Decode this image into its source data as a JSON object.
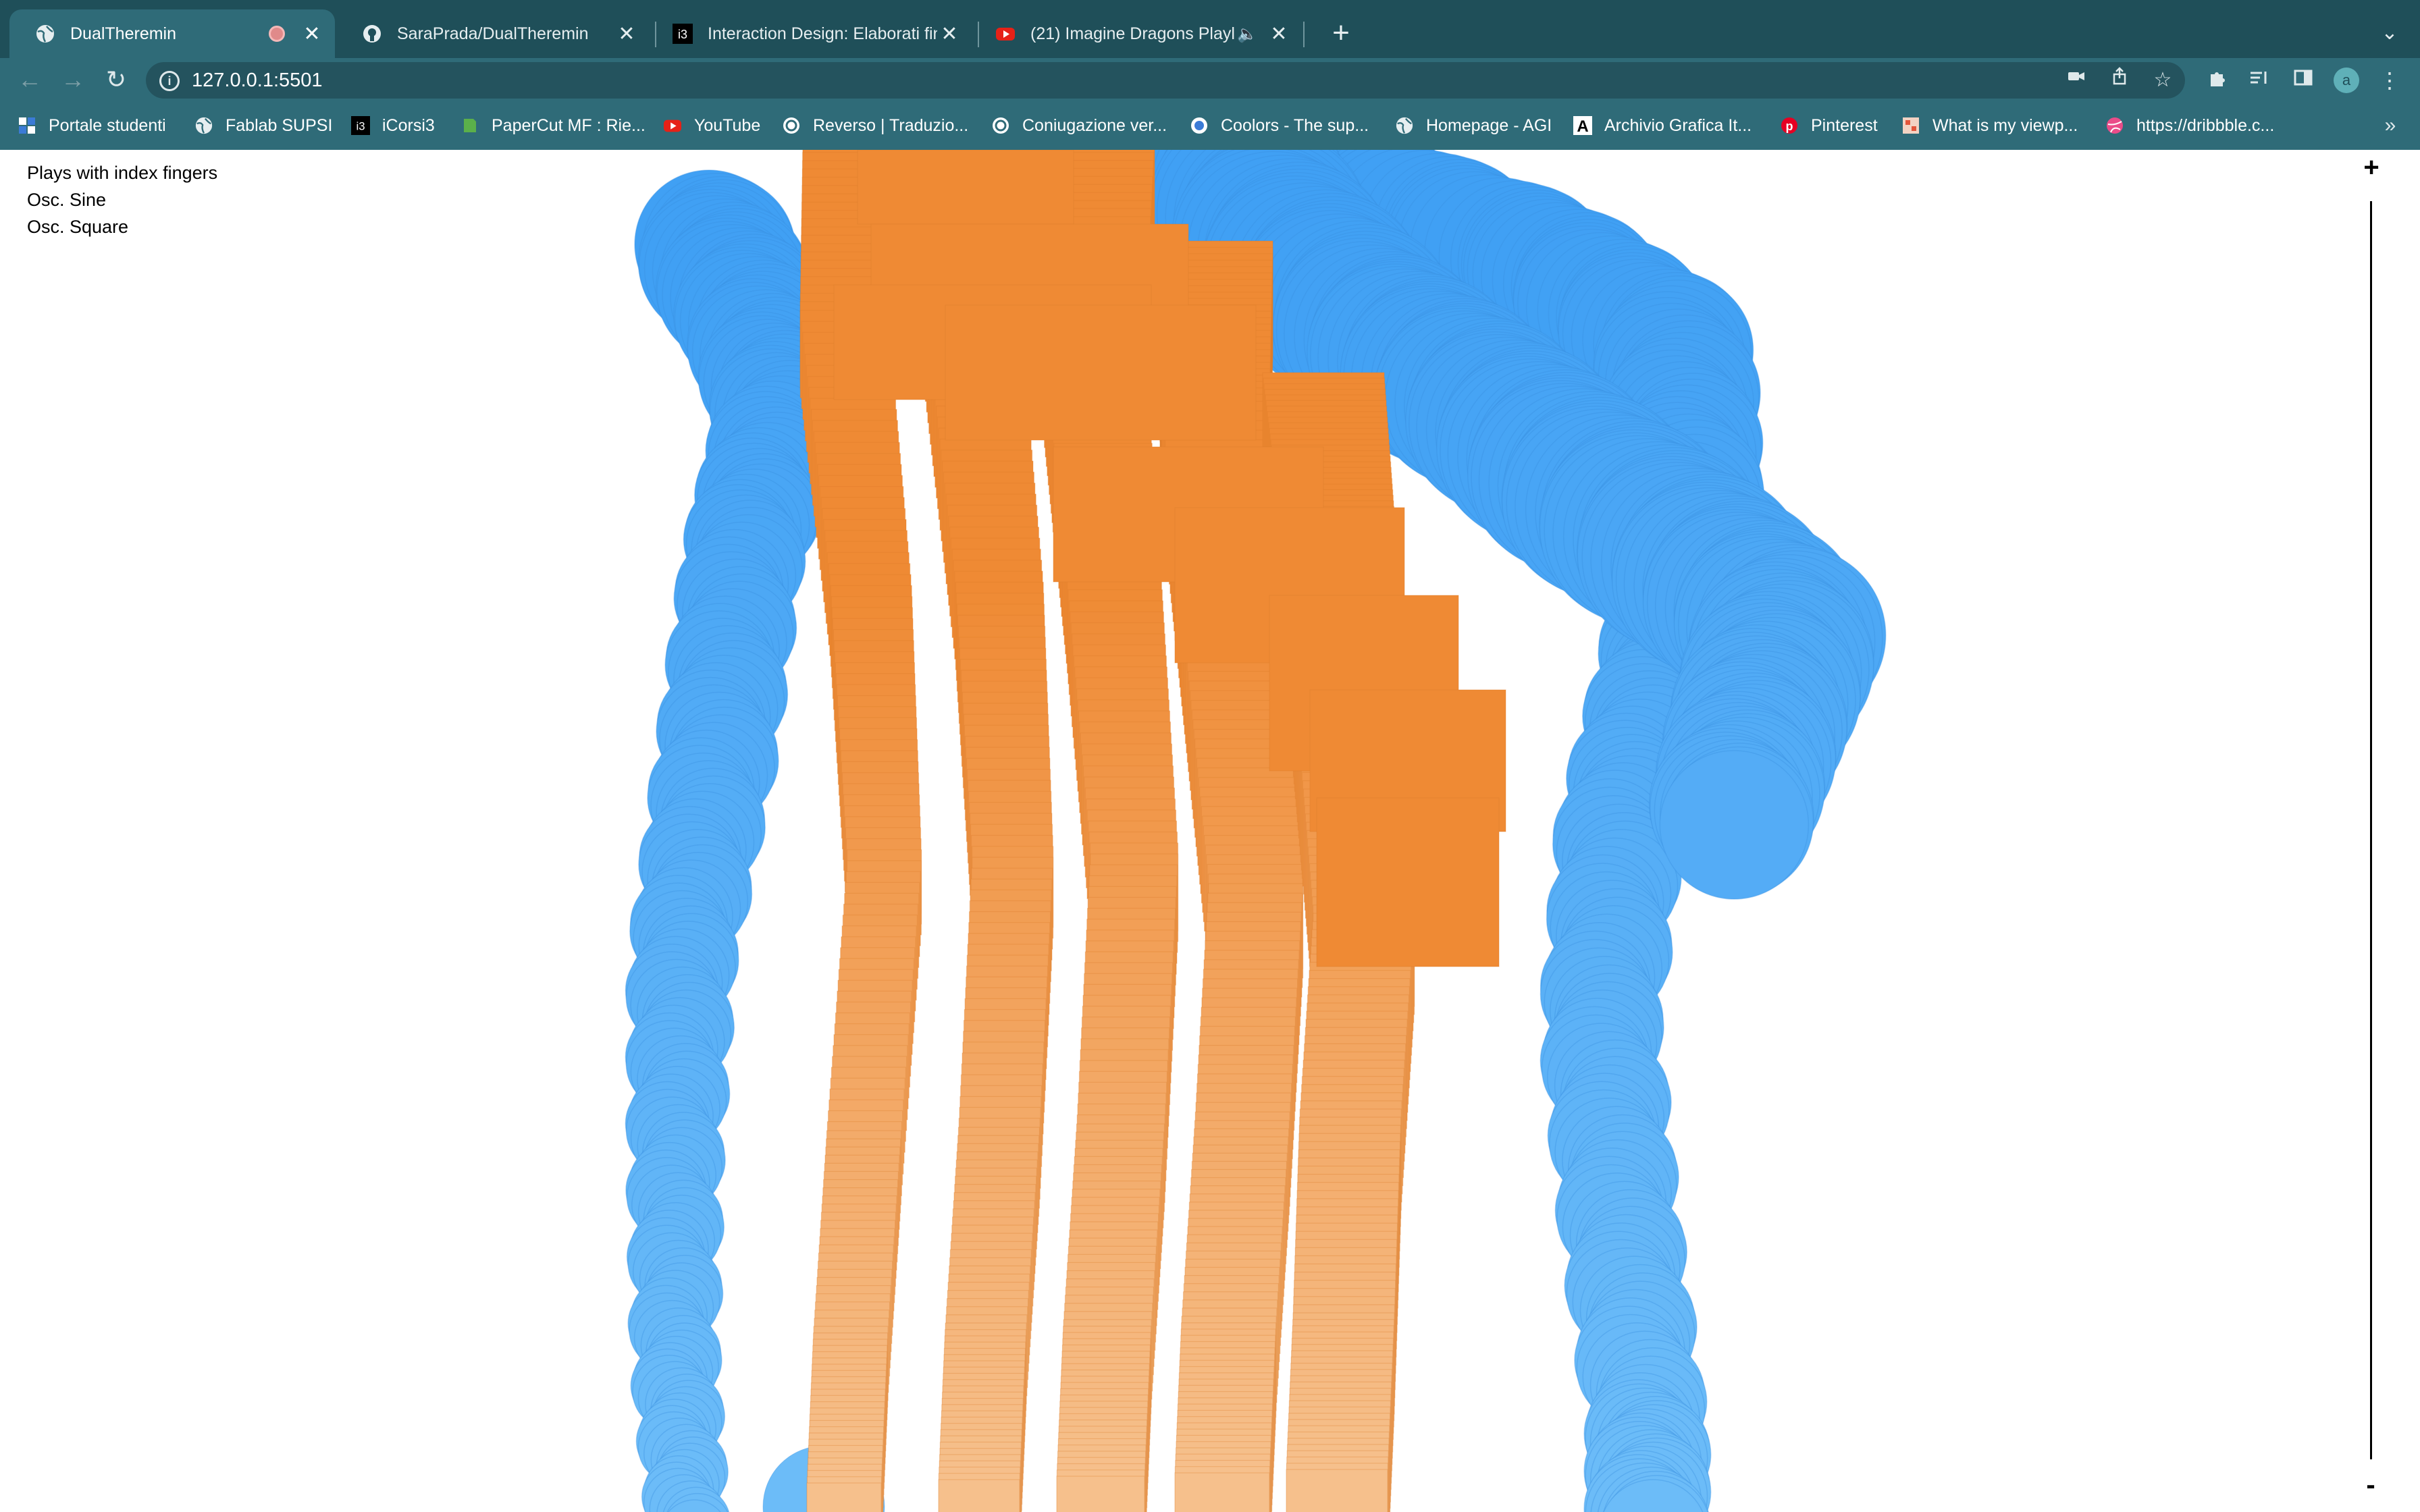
{
  "browser": {
    "tabs": [
      {
        "title": "DualTheremin",
        "icon": "globe-icon",
        "active": true,
        "recording": true
      },
      {
        "title": "SaraPrada/DualTheremin",
        "icon": "github-icon",
        "active": false
      },
      {
        "title": "Interaction Design: Elaborati fin",
        "icon": "i3-icon",
        "active": false
      },
      {
        "title": "(21) Imagine Dragons Playl",
        "icon": "youtube-icon",
        "active": false,
        "audio": true
      }
    ],
    "url": "127.0.0.1:5501",
    "profile_initial": "a",
    "bookmarks": [
      {
        "label": "Portale studenti",
        "icon": "supsi-icon"
      },
      {
        "label": "Fablab SUPSI",
        "icon": "globe-icon"
      },
      {
        "label": "iCorsi3",
        "icon": "i3-icon"
      },
      {
        "label": "PaperCut MF : Rie...",
        "icon": "papercut-icon"
      },
      {
        "label": "YouTube",
        "icon": "youtube-icon"
      },
      {
        "label": "Reverso | Traduzio...",
        "icon": "reverso-icon"
      },
      {
        "label": "Coniugazione ver...",
        "icon": "reverso-icon"
      },
      {
        "label": "Coolors - The sup...",
        "icon": "coolors-icon"
      },
      {
        "label": "Homepage - AGI",
        "icon": "globe-icon"
      },
      {
        "label": "Archivio Grafica It...",
        "icon": "archivio-icon"
      },
      {
        "label": "Pinterest",
        "icon": "pinterest-icon"
      },
      {
        "label": "What is my viewp...",
        "icon": "viewport-icon"
      },
      {
        "label": "https://dribbble.c...",
        "icon": "dribbble-icon"
      }
    ]
  },
  "sketch": {
    "instructions": [
      "Plays with index fingers",
      "Osc. Sine",
      "Osc. Square"
    ],
    "zoom_in": "+",
    "zoom_out": "-",
    "colors": {
      "orange_dark": "#ef8a34",
      "orange_light": "#f6c391",
      "blue_dark": "#40a0f4",
      "blue_light": "#6cbcf8",
      "blue_stroke": "#3a8ee0",
      "orange_stroke": "#d97a28"
    }
  }
}
